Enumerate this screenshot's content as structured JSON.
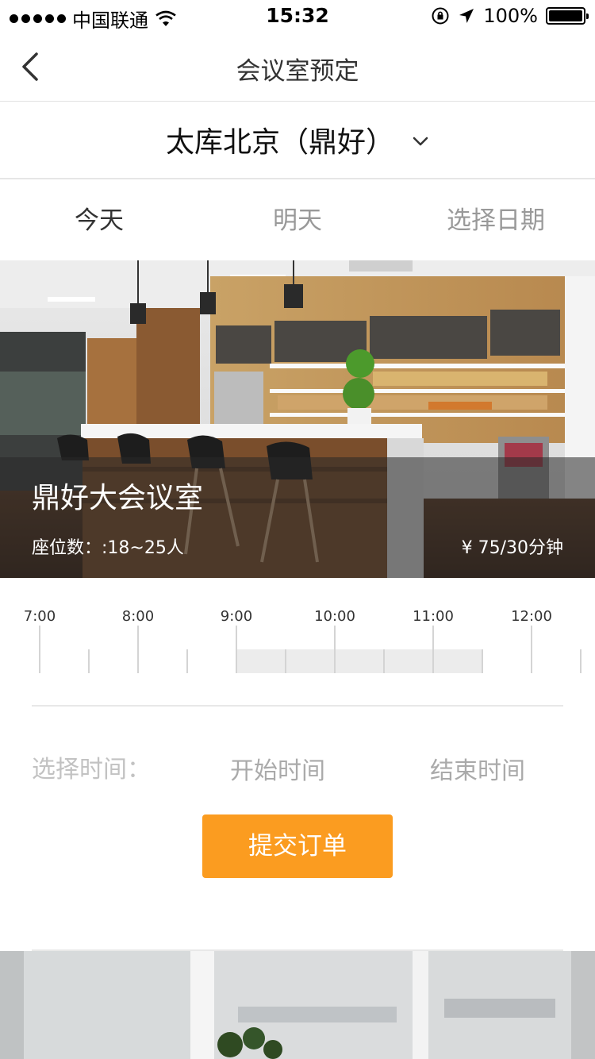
{
  "status_bar": {
    "carrier": "中国联通",
    "time": "15:32",
    "battery": "100%"
  },
  "nav": {
    "title": "会议室预定"
  },
  "location": {
    "name": "太库北京（鼎好）"
  },
  "date_tabs": [
    {
      "label": "今天",
      "active": true
    },
    {
      "label": "明天",
      "active": false
    },
    {
      "label": "选择日期",
      "active": false
    }
  ],
  "room": {
    "name": "鼎好大会议室",
    "seats": "座位数：:18~25人",
    "price": "¥ 75/30分钟"
  },
  "timeline": {
    "labels": [
      "7:00",
      "8:00",
      "9:00",
      "10:00",
      "11:00",
      "12:00"
    ],
    "booked": {
      "start": "9:00",
      "end": "11:30"
    }
  },
  "time_select": {
    "label": "选择时间：",
    "start_placeholder": "开始时间",
    "end_placeholder": "结束时间"
  },
  "submit": {
    "label": "提交订单"
  },
  "colors": {
    "accent": "#fb9c20",
    "overlay": "#282828",
    "booked": "#ececec"
  }
}
